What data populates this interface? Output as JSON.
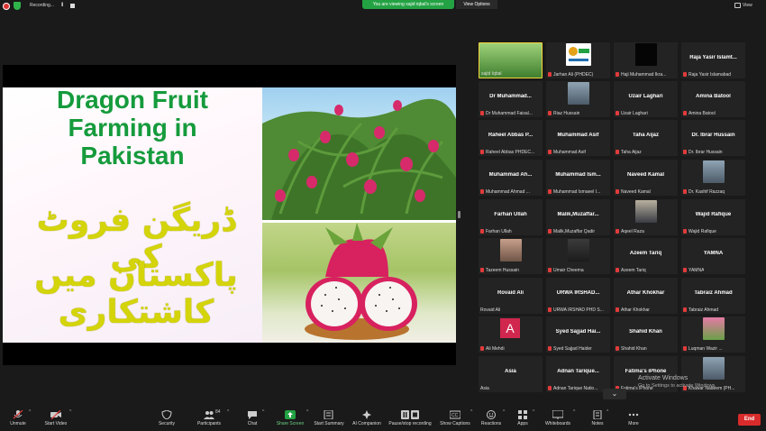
{
  "topbar": {
    "recording_label": "Recording...",
    "pause_glyph": "II",
    "banner": "You are viewing sajid iqbal's screen",
    "view_options": "View Options",
    "view_label": "View"
  },
  "slide": {
    "title": "Dragon Fruit Farming in Pakistan",
    "urdu_line1": "ڈریگن فروٹ کی",
    "urdu_line2": "پاکستان میں کاشتکاری"
  },
  "participants": [
    {
      "name": "",
      "label": "sajid Iqbal",
      "muted": false,
      "kind": "video-green"
    },
    {
      "name": "",
      "label": "Jarhan Ali (PHDEC)",
      "muted": true,
      "kind": "logo"
    },
    {
      "name": "",
      "label": "Haji Muhammad Ikra...",
      "muted": true,
      "kind": "dark"
    },
    {
      "name": "Raja Yasir Islamt...",
      "label": "Raja Yasir Islamabad",
      "muted": true,
      "kind": "name"
    },
    {
      "name": "Dr Muhammad...",
      "label": "Dr Muhammad Faisal...",
      "muted": true,
      "kind": "name"
    },
    {
      "name": "",
      "label": "Riaz Hussain",
      "muted": true,
      "kind": "video-person"
    },
    {
      "name": "Uzair Laghari",
      "label": "Uzair Laghari",
      "muted": true,
      "kind": "name"
    },
    {
      "name": "Amina Batool",
      "label": "Amina Batool",
      "muted": true,
      "kind": "name"
    },
    {
      "name": "Raheel Abbas P...",
      "label": "Raheel Abbas PHDEC...",
      "muted": true,
      "kind": "name"
    },
    {
      "name": "Muhammad Asif",
      "label": "Muhammad Asif",
      "muted": true,
      "kind": "name"
    },
    {
      "name": "Taha Aijaz",
      "label": "Taha Aijaz",
      "muted": true,
      "kind": "name"
    },
    {
      "name": "Dr. Ibrar Hussain",
      "label": "Dr. Ibrar Hussain",
      "muted": true,
      "kind": "name"
    },
    {
      "name": "Muhammad Ah...",
      "label": "Muhammad Ahmad ...",
      "muted": true,
      "kind": "name"
    },
    {
      "name": "Muhammad Ism...",
      "label": "Muhammad Ismaeel I...",
      "muted": true,
      "kind": "name"
    },
    {
      "name": "Naveed Kamal",
      "label": "Naveed Kamal",
      "muted": true,
      "kind": "name"
    },
    {
      "name": "",
      "label": "Dr. Kashif Razzaq",
      "muted": true,
      "kind": "video-person"
    },
    {
      "name": "Farhan Ullah",
      "label": "Farhan Ullah",
      "muted": true,
      "kind": "name"
    },
    {
      "name": "Malik,Muzaffar...",
      "label": "Malik,Muzaffar Qadir",
      "muted": true,
      "kind": "name"
    },
    {
      "name": "",
      "label": "Aqeel Raza",
      "muted": true,
      "kind": "video-suit"
    },
    {
      "name": "Wajid Rafique",
      "label": "Wajid Rafique",
      "muted": true,
      "kind": "name"
    },
    {
      "name": "",
      "label": "Tazeem Hussain",
      "muted": true,
      "kind": "video-couple"
    },
    {
      "name": "",
      "label": "Umair Cheema",
      "muted": true,
      "kind": "video-dim"
    },
    {
      "name": "Azeem Tariq",
      "label": "Azeem Tariq",
      "muted": true,
      "kind": "name"
    },
    {
      "name": "YAMNA",
      "label": "YAMNA",
      "muted": true,
      "kind": "name"
    },
    {
      "name": "Rovaid Ali",
      "label": "Rovaid Ali",
      "muted": false,
      "kind": "name"
    },
    {
      "name": "URWA  IRSHAD...",
      "label": "URWA IRSHAD PHD S...",
      "muted": true,
      "kind": "name"
    },
    {
      "name": "Athar Khokhar",
      "label": "Athar Khokhar",
      "muted": true,
      "kind": "name"
    },
    {
      "name": "Tabraiz Ahmad",
      "label": "Tabraiz Ahmad",
      "muted": true,
      "kind": "name"
    },
    {
      "name": "",
      "label": "Ali Mehdi",
      "muted": true,
      "kind": "avatar",
      "avatar_letter": "A"
    },
    {
      "name": "Syed Sajjad Hai...",
      "label": "Syed Sajjad Haider",
      "muted": true,
      "kind": "name"
    },
    {
      "name": "Shahid Khan",
      "label": "Shahid Khan",
      "muted": true,
      "kind": "name"
    },
    {
      "name": "",
      "label": "Luqman Wazir ...",
      "muted": true,
      "kind": "video-flower"
    },
    {
      "name": "Asia",
      "label": "Asia",
      "muted": false,
      "kind": "name"
    },
    {
      "name": "Adnan Tarique...",
      "label": "Adnan Tarique Natio...",
      "muted": true,
      "kind": "name"
    },
    {
      "name": "Fatima's iPhone",
      "label": "Fatima's iPhone",
      "muted": true,
      "kind": "name"
    },
    {
      "name": "",
      "label": "Khawar Nadeem (PH...",
      "muted": true,
      "kind": "video-person"
    }
  ],
  "watermark": {
    "line1": "Activate Windows",
    "line2": "Go to Settings to activate Windows."
  },
  "scroll_glyph": "⌄",
  "toolbar": {
    "unmute": "Unmute",
    "start_video": "Start Video",
    "security": "Security",
    "participants": "Participants",
    "participants_count": "84",
    "chat": "Chat",
    "share_screen": "Share Screen",
    "start_summary": "Start Summary",
    "ai_companion": "AI Companion",
    "pause_stop": "Pause/stop recording",
    "show_captions": "Show Captions",
    "reactions": "Reactions",
    "apps": "Apps",
    "whiteboards": "Whiteboards",
    "notes": "Notes",
    "more": "More",
    "end": "End"
  },
  "colors": {
    "accent_green": "#23a243",
    "end_red": "#d92b2b",
    "slide_title_green": "#159b3c",
    "urdu_yellow": "#d4d40a"
  }
}
